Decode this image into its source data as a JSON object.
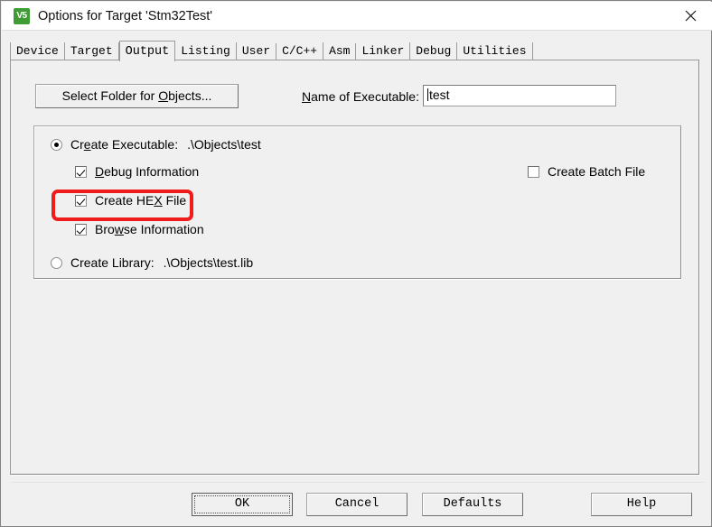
{
  "window": {
    "title": "Options for Target 'Stm32Test'",
    "icon_label": "V5",
    "icon_name": "uvision-logo-icon",
    "close_icon": "close-icon",
    "accent_highlight_color": "#ee1c1c",
    "titlebar_bg": "#ffffff",
    "dialog_bg": "#f0f0f0"
  },
  "tabs": [
    {
      "label": "Device",
      "selected": false
    },
    {
      "label": "Target",
      "selected": false
    },
    {
      "label": "Output",
      "selected": true
    },
    {
      "label": "Listing",
      "selected": false
    },
    {
      "label": "User",
      "selected": false
    },
    {
      "label": "C/C++",
      "selected": false
    },
    {
      "label": "Asm",
      "selected": false
    },
    {
      "label": "Linker",
      "selected": false
    },
    {
      "label": "Debug",
      "selected": false
    },
    {
      "label": "Utilities",
      "selected": false
    }
  ],
  "output_page": {
    "select_folder_button": "Select Folder for Objects...",
    "select_folder_button_pre": "Select Folder for ",
    "select_folder_button_mnemonic": "O",
    "select_folder_button_post": "bjects...",
    "name_of_executable_label": "Name of Executable:",
    "name_of_executable_mnemonic": "N",
    "name_of_executable_rest": "ame of Executable:",
    "executable_value": "test",
    "executable_placeholder": "",
    "create_executable": {
      "label": "Create Executable:",
      "label_pre": "Cr",
      "label_mnemonic": "e",
      "label_post": "ate Executable:",
      "path": ".\\Objects\\test",
      "checked": true
    },
    "debug_information": {
      "label": "Debug Information",
      "label_mnemonic": "D",
      "label_rest": "ebug Information",
      "checked": true
    },
    "create_hex_file": {
      "label": "Create HEX File",
      "label_pre": "Create HE",
      "label_mnemonic": "X",
      "label_post": " File",
      "checked": true,
      "highlighted": true
    },
    "browse_information": {
      "label": "Browse Information",
      "label_pre": "Bro",
      "label_mnemonic": "w",
      "label_post": "se Information",
      "checked": true
    },
    "create_batch_file": {
      "label": "Create Batch File",
      "checked": false
    },
    "create_library": {
      "label": "Create Library:",
      "path": ".\\Objects\\test.lib",
      "checked": false
    }
  },
  "footer": {
    "ok": "OK",
    "cancel": "Cancel",
    "defaults": "Defaults",
    "help": "Help",
    "focused_button": "OK"
  }
}
